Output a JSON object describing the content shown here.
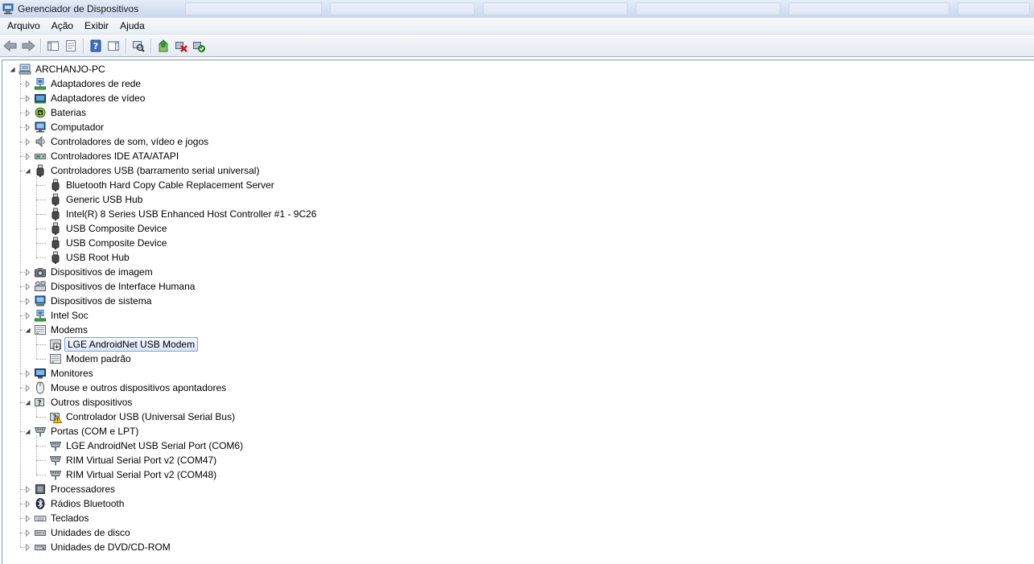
{
  "window": {
    "title": "Gerenciador de Dispositivos"
  },
  "menu": {
    "items": [
      "Arquivo",
      "Ação",
      "Exibir",
      "Ajuda"
    ]
  },
  "toolbar": {
    "buttons": [
      "back-arrow-icon",
      "forward-arrow-icon",
      "console-tree-icon",
      "properties-icon",
      "help-icon",
      "action-pane-icon",
      "scan-hardware-icon",
      "update-driver-icon",
      "uninstall-icon",
      "enable-device-icon"
    ]
  },
  "tree": {
    "root": "ARCHANJO-PC",
    "categories": [
      {
        "label": "Adaptadores de rede",
        "icon": "network-adapter-icon",
        "expanded": false
      },
      {
        "label": "Adaptadores de vídeo",
        "icon": "display-adapter-icon",
        "expanded": false
      },
      {
        "label": "Baterias",
        "icon": "battery-icon",
        "expanded": false
      },
      {
        "label": "Computador",
        "icon": "computer-icon",
        "expanded": false
      },
      {
        "label": "Controladores de som, vídeo e jogos",
        "icon": "speaker-icon",
        "expanded": false
      },
      {
        "label": "Controladores IDE ATA/ATAPI",
        "icon": "ide-controller-icon",
        "expanded": false
      },
      {
        "label": "Controladores USB (barramento serial universal)",
        "icon": "usb-icon",
        "expanded": true,
        "children": [
          {
            "label": "Bluetooth Hard Copy Cable Replacement Server",
            "icon": "usb-icon"
          },
          {
            "label": "Generic USB Hub",
            "icon": "usb-icon"
          },
          {
            "label": "Intel(R) 8 Series USB Enhanced Host Controller #1 - 9C26",
            "icon": "usb-icon"
          },
          {
            "label": "USB Composite Device",
            "icon": "usb-icon"
          },
          {
            "label": "USB Composite Device",
            "icon": "usb-icon"
          },
          {
            "label": "USB Root Hub",
            "icon": "usb-icon"
          }
        ]
      },
      {
        "label": "Dispositivos de imagem",
        "icon": "camera-icon",
        "expanded": false
      },
      {
        "label": "Dispositivos de Interface Humana",
        "icon": "hid-icon",
        "expanded": false
      },
      {
        "label": "Dispositivos de sistema",
        "icon": "system-device-icon",
        "expanded": false
      },
      {
        "label": "Intel Soc",
        "icon": "network-adapter-icon",
        "expanded": false
      },
      {
        "label": "Modems",
        "icon": "modem-icon",
        "expanded": true,
        "children": [
          {
            "label": "LGE AndroidNet USB Modem",
            "icon": "modem-icon",
            "selected": true,
            "overlay": "down-arrow"
          },
          {
            "label": "Modem padrão",
            "icon": "modem-icon"
          }
        ]
      },
      {
        "label": "Monitores",
        "icon": "monitor-icon",
        "expanded": false
      },
      {
        "label": "Mouse e outros dispositivos apontadores",
        "icon": "mouse-icon",
        "expanded": false
      },
      {
        "label": "Outros dispositivos",
        "icon": "unknown-device-icon",
        "expanded": true,
        "children": [
          {
            "label": "Controlador USB (Universal Serial Bus)",
            "icon": "unknown-device-icon",
            "overlay": "warning"
          }
        ]
      },
      {
        "label": "Portas (COM e LPT)",
        "icon": "port-icon",
        "expanded": true,
        "children": [
          {
            "label": "LGE AndroidNet USB Serial Port (COM6)",
            "icon": "port-icon"
          },
          {
            "label": "RIM Virtual Serial Port v2 (COM47)",
            "icon": "port-icon"
          },
          {
            "label": "RIM Virtual Serial Port v2 (COM48)",
            "icon": "port-icon"
          }
        ]
      },
      {
        "label": "Processadores",
        "icon": "processor-icon",
        "expanded": false
      },
      {
        "label": "Rádios Bluetooth",
        "icon": "bluetooth-icon",
        "expanded": false
      },
      {
        "label": "Teclados",
        "icon": "keyboard-icon",
        "expanded": false
      },
      {
        "label": "Unidades de disco",
        "icon": "disk-drive-icon",
        "expanded": false
      },
      {
        "label": "Unidades de DVD/CD-ROM",
        "icon": "dvd-drive-icon",
        "expanded": false
      }
    ]
  },
  "colors": {
    "selection_border": "#7da2ce",
    "selection_fill": "#d9e7f8",
    "tree_lines": "#a0a0a0"
  }
}
